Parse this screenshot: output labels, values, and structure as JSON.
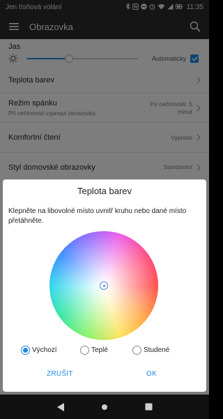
{
  "status_bar": {
    "carrier": "Jen tísňová volání",
    "time": "11:35",
    "icons": [
      "bluetooth-icon",
      "nfc-icon",
      "do-not-disturb-icon",
      "alarm-icon",
      "wifi-icon",
      "signal-icon",
      "battery-icon"
    ]
  },
  "toolbar": {
    "title": "Obrazovka",
    "menu_icon": "menu-icon",
    "search_icon": "search-icon"
  },
  "settings": {
    "brightness": {
      "label": "Jas",
      "level": 0.38,
      "auto_label": "Automaticky",
      "auto_checked": true
    },
    "items": [
      {
        "title": "Teplota barev",
        "subtitle": "",
        "value": ""
      },
      {
        "title": "Režim spánku",
        "subtitle": "Při nečinnosti vypnout obrazovku",
        "value": "Po nečinnosti: 5 minut"
      },
      {
        "title": "Komfortní čtení",
        "subtitle": "",
        "value": "Vypnuto"
      },
      {
        "title": "Styl domovské obrazovky",
        "subtitle": "",
        "value": "Standardní"
      }
    ]
  },
  "dialog": {
    "title": "Teplota barev",
    "description": "Klepněte na libovolné místo uvnitř kruhu nebo dané místo přetáhněte.",
    "options": [
      {
        "label": "Výchozí",
        "selected": true
      },
      {
        "label": "Teplé",
        "selected": false
      },
      {
        "label": "Studené",
        "selected": false
      }
    ],
    "cancel_label": "ZRUŠIT",
    "ok_label": "OK"
  },
  "colors": {
    "accent": "#1e88e5",
    "toolbar_bg": "#2b2b2b",
    "navbar_bg": "#111111"
  }
}
